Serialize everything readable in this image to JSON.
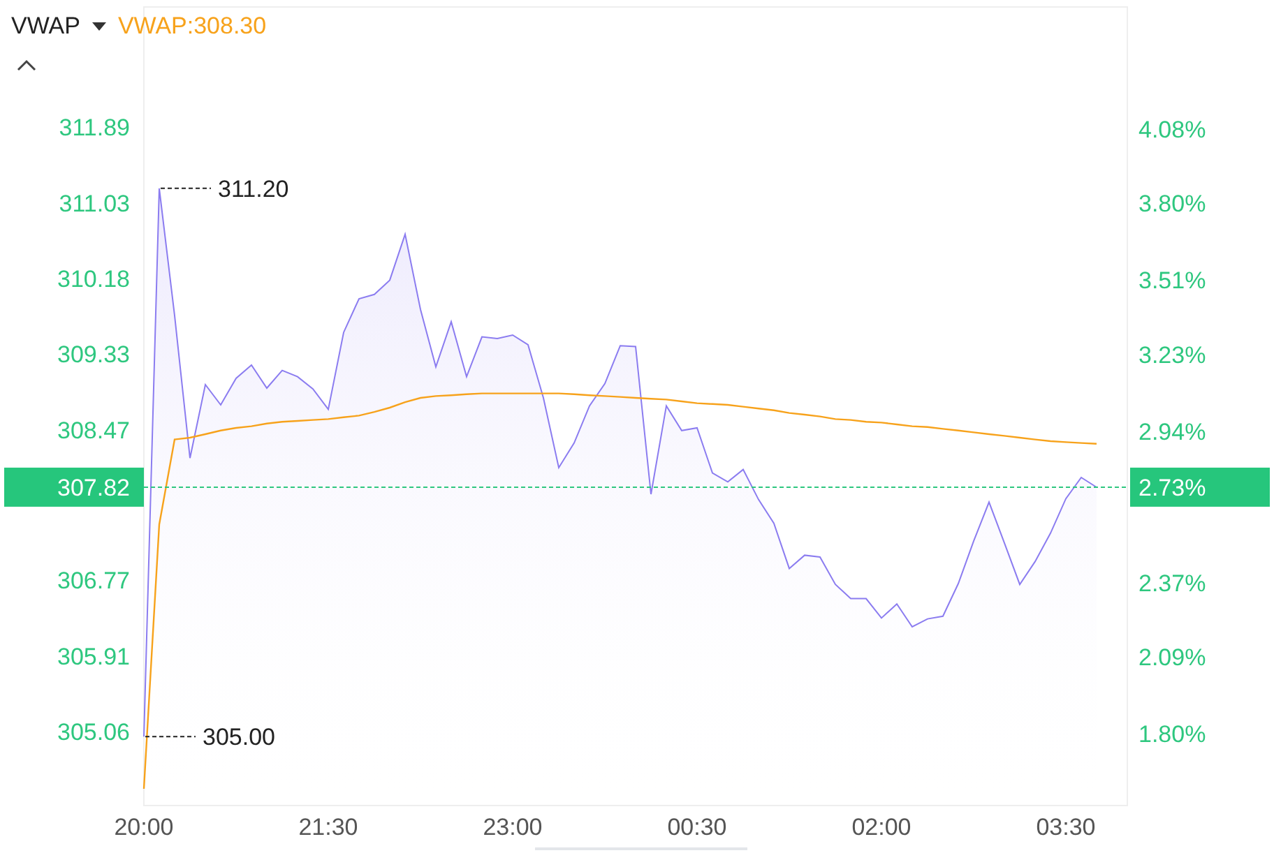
{
  "indicator": {
    "value_label": "VWAP:308.30"
  },
  "chart_data": {
    "type": "area",
    "ylim": [
      304.22,
      313.25
    ],
    "y2lim": [
      1.53,
      4.54
    ],
    "categories": [
      "20:00",
      null,
      null,
      null,
      null,
      null,
      null,
      null,
      null,
      null,
      null,
      null,
      "21:30",
      null,
      null,
      null,
      null,
      null,
      null,
      null,
      null,
      null,
      null,
      null,
      "23:00",
      null,
      null,
      null,
      null,
      null,
      null,
      null,
      null,
      null,
      null,
      null,
      "00:30",
      null,
      null,
      null,
      null,
      null,
      null,
      null,
      null,
      null,
      null,
      null,
      "02:00",
      null,
      null,
      null,
      null,
      null,
      null,
      null,
      null,
      null,
      null,
      null,
      "03:30",
      null,
      null
    ],
    "yticks": [
      {
        "value": 311.89,
        "label": "311.89"
      },
      {
        "value": 311.03,
        "label": "311.03"
      },
      {
        "value": 310.18,
        "label": "310.18"
      },
      {
        "value": 309.33,
        "label": "309.33"
      },
      {
        "value": 308.47,
        "label": "308.47"
      },
      {
        "value": 306.77,
        "label": "306.77"
      },
      {
        "value": 305.91,
        "label": "305.91"
      },
      {
        "value": 305.06,
        "label": "305.06"
      }
    ],
    "y2ticks": [
      {
        "value": 4.08,
        "label": "4.08%"
      },
      {
        "value": 3.8,
        "label": "3.80%"
      },
      {
        "value": 3.51,
        "label": "3.51%"
      },
      {
        "value": 3.23,
        "label": "3.23%"
      },
      {
        "value": 2.94,
        "label": "2.94%"
      },
      {
        "value": 2.37,
        "label": "2.37%"
      },
      {
        "value": 2.09,
        "label": "2.09%"
      },
      {
        "value": 1.8,
        "label": "1.80%"
      }
    ],
    "series": [
      {
        "color": "#8b7cf0",
        "values": [
          305.0,
          311.2,
          309.76,
          308.15,
          308.98,
          308.75,
          309.05,
          309.2,
          308.94,
          309.14,
          309.07,
          308.93,
          308.7,
          309.57,
          309.95,
          310.0,
          310.16,
          310.68,
          309.83,
          309.18,
          309.69,
          309.07,
          309.52,
          309.5,
          309.54,
          309.43,
          308.83,
          308.04,
          308.32,
          308.74,
          308.99,
          309.42,
          309.41,
          307.74,
          308.74,
          308.46,
          308.49,
          307.98,
          307.88,
          308.02,
          307.68,
          307.41,
          306.9,
          307.05,
          307.03,
          306.72,
          306.56,
          306.56,
          306.34,
          306.5,
          306.24,
          306.33,
          306.36,
          306.73,
          307.21,
          307.65,
          307.19,
          306.72,
          306.98,
          307.3,
          307.69,
          307.93,
          307.82
        ]
      },
      {
        "name": "VWAP",
        "type": "line",
        "color": "#f7a21b",
        "values": [
          304.41,
          307.4,
          308.36,
          308.38,
          308.42,
          308.46,
          308.49,
          308.51,
          308.54,
          308.56,
          308.57,
          308.58,
          308.59,
          308.61,
          308.63,
          308.67,
          308.72,
          308.78,
          308.83,
          308.85,
          308.86,
          308.87,
          308.88,
          308.88,
          308.88,
          308.88,
          308.88,
          308.88,
          308.87,
          308.86,
          308.85,
          308.84,
          308.83,
          308.82,
          308.81,
          308.79,
          308.77,
          308.76,
          308.75,
          308.73,
          308.71,
          308.69,
          308.66,
          308.64,
          308.62,
          308.59,
          308.58,
          308.56,
          308.55,
          308.53,
          308.51,
          308.5,
          308.48,
          308.46,
          308.44,
          308.42,
          308.4,
          308.38,
          308.36,
          308.34,
          308.33,
          308.32,
          308.31
        ]
      }
    ],
    "annotations": [
      "311.20",
      "305.00"
    ],
    "ref_lines": [
      {
        "axis": "y",
        "value": 307.82,
        "label": "307.82",
        "color": "#2ec77f"
      }
    ]
  },
  "current_percent_badge": "2.73%"
}
